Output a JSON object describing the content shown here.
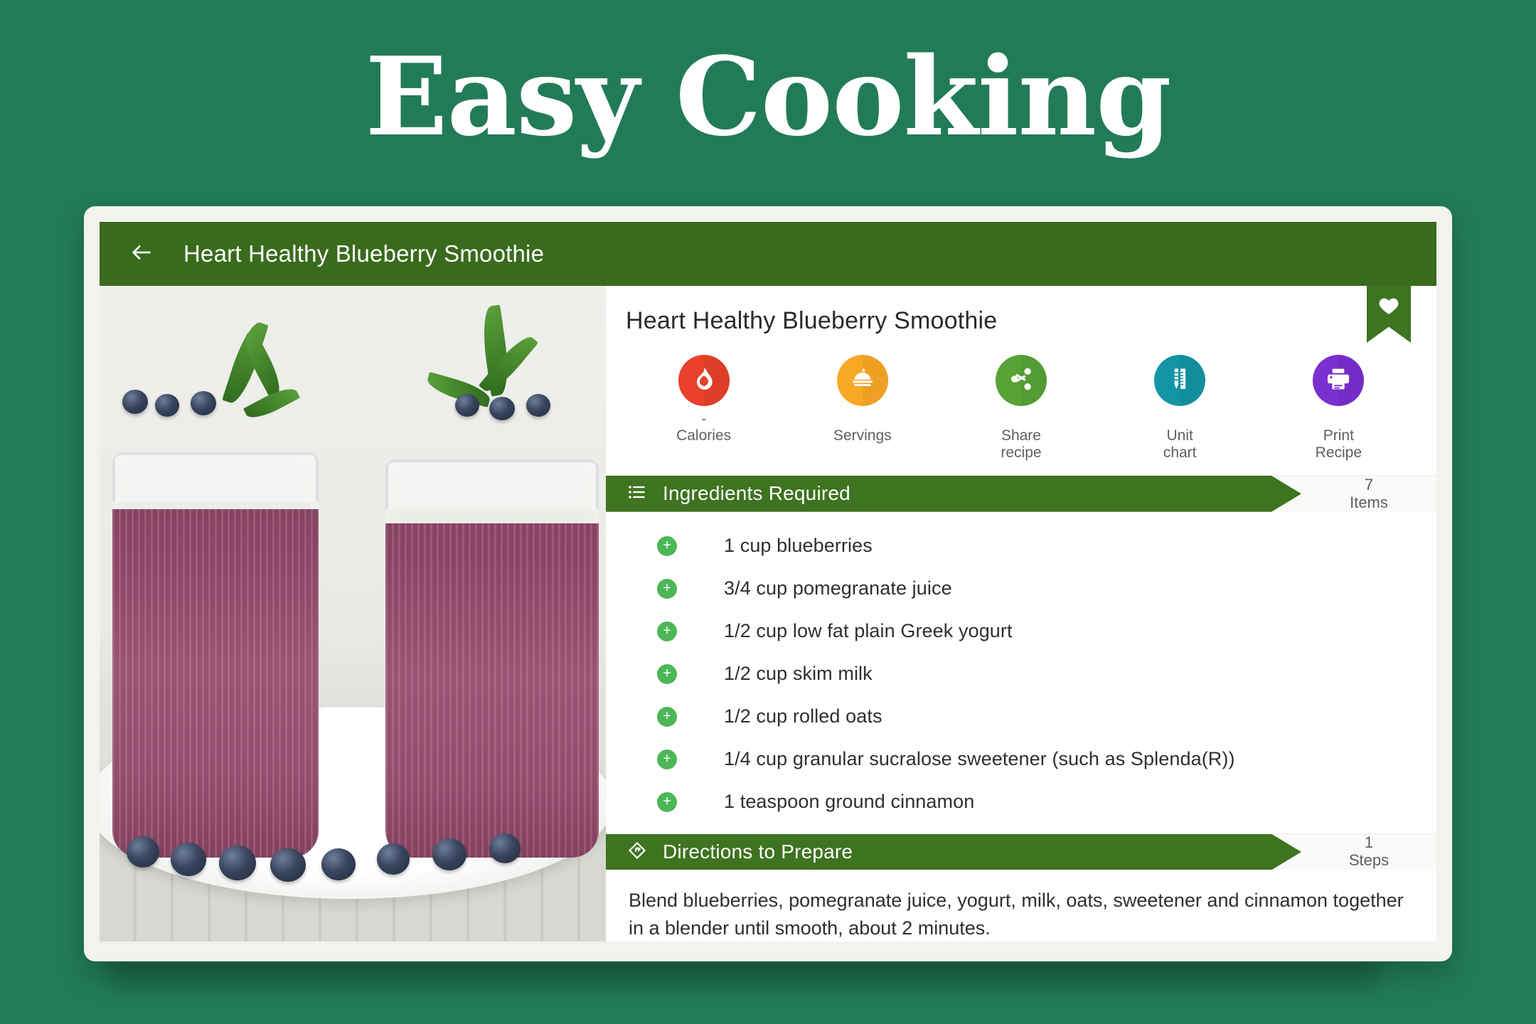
{
  "hero": {
    "title": "Easy Cooking"
  },
  "appbar": {
    "back_icon": "arrow-left-icon",
    "title": "Heart Healthy Blueberry Smoothie"
  },
  "recipe": {
    "title": "Heart Healthy Blueberry Smoothie",
    "bookmark_icon": "heart-icon"
  },
  "actions": [
    {
      "icon": "flame-heart-icon",
      "value": "-",
      "label": "Calories",
      "color": "#E8402A"
    },
    {
      "icon": "cloche-icon",
      "value": "",
      "label": "Servings",
      "color": "#F9A826"
    },
    {
      "icon": "share-icon",
      "value": "",
      "label": "Share\nrecipe",
      "color": "#57A336"
    },
    {
      "icon": "ruler-icon",
      "value": "",
      "label": "Unit\nchart",
      "color": "#1395A5"
    },
    {
      "icon": "printer-icon",
      "value": "",
      "label": "Print\nRecipe",
      "color": "#7A2FD0"
    }
  ],
  "ingredients_section": {
    "icon": "list-icon",
    "label": "Ingredients Required",
    "count": "7",
    "count_unit": "Items",
    "items": [
      "1 cup blueberries",
      "3/4 cup pomegranate juice",
      "1/2 cup low fat plain Greek yogurt",
      "1/2 cup skim milk",
      "1/2 cup rolled oats",
      "1/4 cup granular sucralose sweetener (such as Splenda(R))",
      "1 teaspoon ground cinnamon"
    ],
    "add_icon": "plus-icon"
  },
  "directions_section": {
    "icon": "directions-sign-icon",
    "label": "Directions to Prepare",
    "count": "1",
    "count_unit": "Steps",
    "steps": [
      "Blend blueberries, pomegranate juice, yogurt, milk, oats, sweetener and cinnamon together in a blender until smooth, about 2 minutes."
    ]
  },
  "theme": {
    "page_background": "#227B57",
    "appbar_green": "#396B1D",
    "band_green": "#3E7320",
    "accent_plus": "#4CB757"
  },
  "photo": {
    "alt": "two glasses of blueberry smoothie garnished with mint on a white plate with fresh blueberries"
  }
}
